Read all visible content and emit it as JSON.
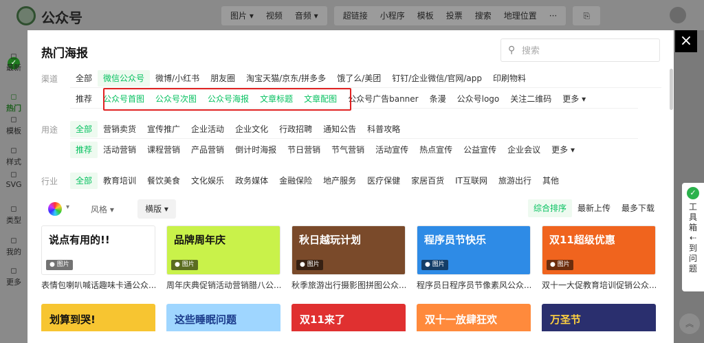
{
  "app": {
    "name": "公众号"
  },
  "topmenu": {
    "groups": [
      [
        "图片 ▾",
        "视频",
        "音频 ▾"
      ],
      [
        "超链接",
        "小程序",
        "模板",
        "投票",
        "搜索",
        "地理位置",
        "···"
      ]
    ]
  },
  "leftnav": [
    {
      "label": "最新",
      "icon": "news-icon"
    },
    {
      "label": "热门",
      "icon": "flame-icon"
    },
    {
      "label": "模板",
      "icon": "template-icon"
    },
    {
      "label": "样式",
      "icon": "palette-icon"
    },
    {
      "label": "SVG",
      "icon": "svg-icon"
    },
    {
      "label": "类型",
      "icon": "grid-icon"
    },
    {
      "label": "我的",
      "icon": "user-icon"
    },
    {
      "label": "更多",
      "icon": "more-icon"
    }
  ],
  "modal": {
    "title": "热门海报",
    "search_placeholder": "搜索",
    "close": "×"
  },
  "filters": {
    "channel": {
      "label": "渠道",
      "items": [
        "全部",
        "微信公众号",
        "微博/小红书",
        "朋友圈",
        "淘宝天猫/京东/拼多多",
        "饿了么/美团",
        "钉钉/企业微信/官网/app",
        "印刷物料"
      ],
      "selected": 1,
      "sub": [
        "推荐",
        "公众号首图",
        "公众号次图",
        "公众号海报",
        "文章标题",
        "文章配图",
        "公众号广告banner",
        "条漫",
        "公众号logo",
        "关注二维码",
        "更多 ▾"
      ],
      "sub_highlight": [
        1,
        2,
        3,
        4,
        5
      ]
    },
    "usage": {
      "label": "用途",
      "items": [
        "全部",
        "营销卖货",
        "宣传推广",
        "企业活动",
        "企业文化",
        "行政招聘",
        "通知公告",
        "科普攻略"
      ],
      "selected": 0,
      "sub": [
        "推荐",
        "活动营销",
        "课程营销",
        "产品营销",
        "倒计时海报",
        "节日营销",
        "节气营销",
        "活动宣传",
        "热点宣传",
        "公益宣传",
        "企业会议",
        "更多 ▾"
      ],
      "sub_selected": 0
    },
    "industry": {
      "label": "行业",
      "items": [
        "全部",
        "教育培训",
        "餐饮美食",
        "文化娱乐",
        "政务媒体",
        "金融保险",
        "地产服务",
        "医疗保健",
        "家居百货",
        "IT互联网",
        "旅游出行",
        "其他"
      ],
      "selected": 0
    }
  },
  "toolbar": {
    "style_label": "风格",
    "orientation_label": "横版",
    "sorts": [
      "综合排序",
      "最新上传",
      "最多下载"
    ],
    "sort_selected": 0
  },
  "cards": [
    {
      "caption": "表情包喇叭喊话趣味卡通公众...",
      "headline": "说点有用的!!",
      "tag": "图片",
      "bg": "#ffffff",
      "fg": "#111111"
    },
    {
      "caption": "周年庆典促销活动营销腊八公...",
      "headline": "品牌周年庆",
      "tag": "图片",
      "bg": "#c9f24a",
      "fg": "#111111"
    },
    {
      "caption": "秋季旅游出行摄影图拼图公众...",
      "headline": "秋日越玩计划",
      "tag": "图片",
      "bg": "#7a4a2a",
      "fg": "#ffffff"
    },
    {
      "caption": "程序员日程序员节像素风公众...",
      "headline": "程序员节快乐",
      "tag": "图片",
      "bg": "#2e8be6",
      "fg": "#ffffff"
    },
    {
      "caption": "双十一大促教育培训促销公众...",
      "headline": "双11超级优惠",
      "tag": "图片",
      "bg": "#f0641e",
      "fg": "#ffffff"
    }
  ],
  "cards_row2": [
    {
      "headline": "划算到哭!",
      "bg": "#f7c531",
      "fg": "#111111"
    },
    {
      "headline": "这些睡眠问题",
      "bg": "#9fd6ff",
      "fg": "#1a3a8a"
    },
    {
      "headline": "双11来了",
      "bg": "#e03030",
      "fg": "#ffffff"
    },
    {
      "headline": "双十一放肆狂欢",
      "bg": "#ff8a3c",
      "fg": "#ffffff"
    },
    {
      "headline": "万圣节",
      "bg": "#2a2f6e",
      "fg": "#ffd23f"
    }
  ],
  "toolbox": {
    "label": "工具箱",
    "label2": "到问题"
  },
  "colors": {
    "accent": "#07c160",
    "highlight": "#e02020"
  }
}
